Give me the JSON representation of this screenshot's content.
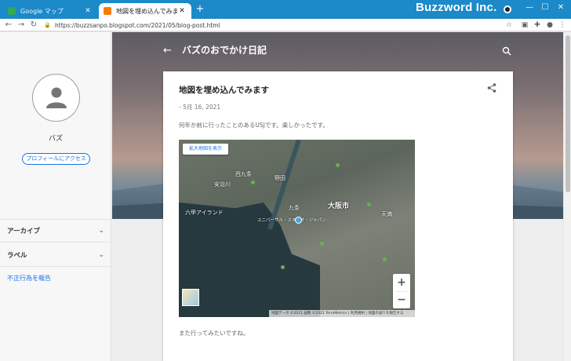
{
  "browser": {
    "tabs": [
      {
        "title": "Google マップ",
        "active": false
      },
      {
        "title": "地図を埋め込んでみます",
        "active": true
      }
    ],
    "brand": "Buzzword Inc.",
    "url": "https://buzzsanpo.blogspot.com/2021/05/blog-post.html"
  },
  "sidebar": {
    "profile_name": "バズ",
    "profile_button": "プロフィールにアクセス",
    "items": [
      {
        "label": "アーカイブ"
      },
      {
        "label": "ラベル"
      }
    ],
    "report_link": "不正行為を報告"
  },
  "blog": {
    "title": "バズのおでかけ日記"
  },
  "post": {
    "title": "地図を埋め込んでみます",
    "date": "- 5月 16, 2021",
    "body_before_map": "何年か前に行ったことのあるUSJです。楽しかったです。",
    "body_after_map": "また行ってみたいですね。"
  },
  "map": {
    "larger_map_button": "拡大地図を表示",
    "labels": {
      "area1": "西九条",
      "area2": "安治川",
      "area3": "野田",
      "area4": "六甲アイランド",
      "area5": "九条",
      "area6": "大阪市",
      "area7": "天満",
      "area8": "ユニバーサル・スタジオ・ジャパン"
    },
    "zoom_in": "+",
    "zoom_out": "−",
    "attribution": "地図データ ©2021 画像 ©2021 TerraMetrics | 利用規約 | 地図の誤りを報告する"
  }
}
